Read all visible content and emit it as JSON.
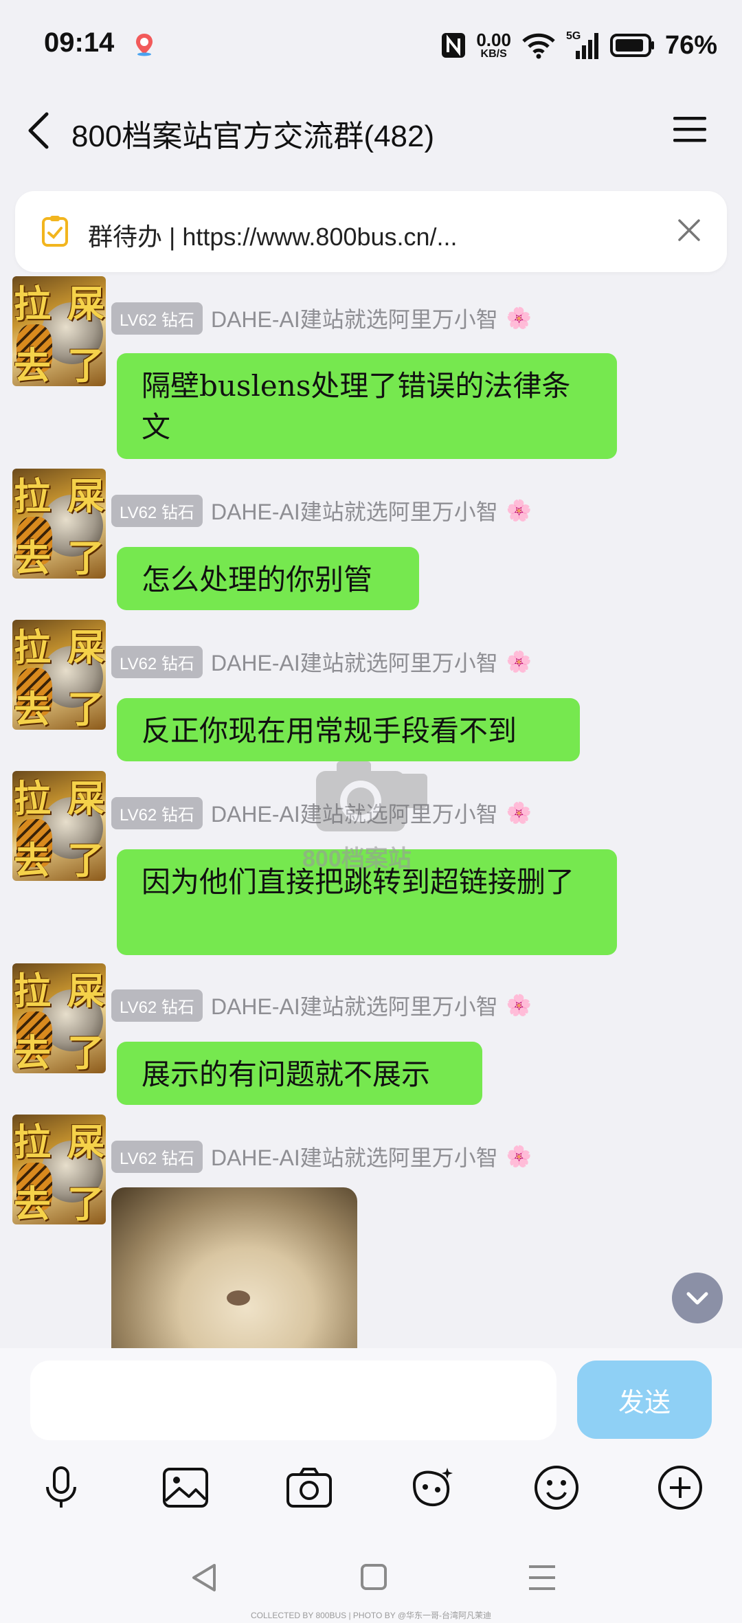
{
  "status_bar": {
    "time": "09:14",
    "net_speed_value": "0.00",
    "net_speed_unit": "KB/S",
    "signal_label": "5G",
    "battery_percent": "76%"
  },
  "header": {
    "title": "800档案站官方交流群(482)"
  },
  "todo_banner": {
    "text": "群待办 | https://www.800bus.cn/..."
  },
  "messages": [
    {
      "level": "LV62 钻石",
      "nickname": "DAHE-AI建站就选阿里万小智",
      "flower": "🌸",
      "text": "隔壁buslens处理了错误的法律条文"
    },
    {
      "level": "LV62 钻石",
      "nickname": "DAHE-AI建站就选阿里万小智",
      "flower": "🌸",
      "text": "怎么处理的你别管"
    },
    {
      "level": "LV62 钻石",
      "nickname": "DAHE-AI建站就选阿里万小智",
      "flower": "🌸",
      "text": "反正你现在用常规手段看不到"
    },
    {
      "level": "LV62 钻石",
      "nickname": "DAHE-AI建站就选阿里万小智",
      "flower": "🌸",
      "text": "因为他们直接把跳转到超链接删了"
    },
    {
      "level": "LV62 钻石",
      "nickname": "DAHE-AI建站就选阿里万小智",
      "flower": "🌸",
      "text": "展示的有问题就不展示"
    },
    {
      "level": "LV62 钻石",
      "nickname": "DAHE-AI建站就选阿里万小智",
      "flower": "🌸",
      "text": ""
    }
  ],
  "avatar_chars": [
    "拉",
    "屎",
    "去",
    "了"
  ],
  "watermark": "800档案站",
  "composer": {
    "send_label": "发送"
  },
  "footer": "COLLECTED BY 800BUS | PHOTO BY @华东一哥-台湾阿凡茉迪",
  "colors": {
    "bubble": "#76e84f",
    "send_button": "#8fd0f5",
    "level_badge": "#b9b9bf"
  }
}
